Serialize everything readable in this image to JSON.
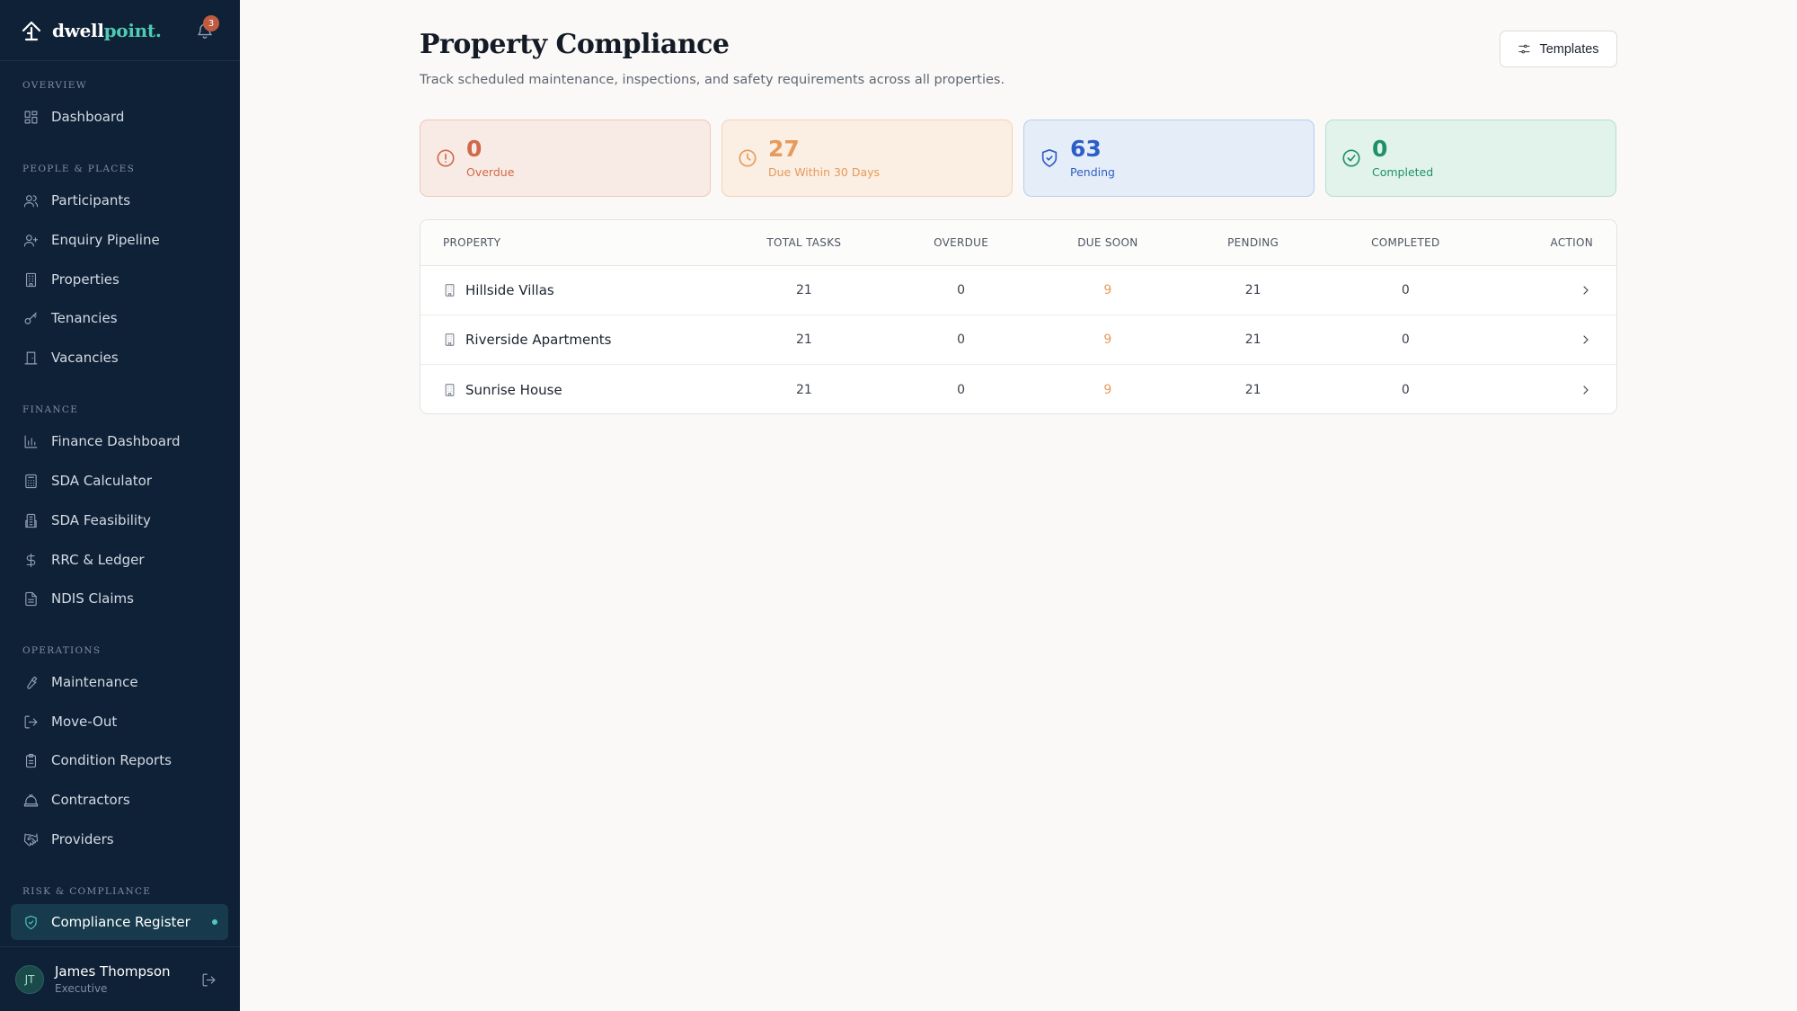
{
  "brand": {
    "name_part1": "dwell",
    "name_part2": "point.",
    "notification_count": "3"
  },
  "sidebar": {
    "sections": {
      "overview": "Overview",
      "people": "People & Places",
      "finance": "Finance",
      "operations": "Operations",
      "risk": "Risk & Compliance"
    },
    "items": {
      "dashboard": "Dashboard",
      "participants": "Participants",
      "enquiry": "Enquiry Pipeline",
      "properties": "Properties",
      "tenancies": "Tenancies",
      "vacancies": "Vacancies",
      "finance_dashboard": "Finance Dashboard",
      "sda_calculator": "SDA Calculator",
      "sda_feasibility": "SDA Feasibility",
      "rrc_ledger": "RRC & Ledger",
      "ndis_claims": "NDIS Claims",
      "maintenance": "Maintenance",
      "move_out": "Move-Out",
      "condition_reports": "Condition Reports",
      "contractors": "Contractors",
      "providers": "Providers",
      "compliance_register": "Compliance Register"
    }
  },
  "user": {
    "initials": "JT",
    "name": "James Thompson",
    "role": "Executive"
  },
  "page": {
    "title": "Property Compliance",
    "subtitle": "Track scheduled maintenance, inspections, and safety requirements across all properties.",
    "templates_label": "Templates"
  },
  "stats": {
    "overdue": {
      "value": "0",
      "label": "Overdue"
    },
    "due": {
      "value": "27",
      "label": "Due Within 30 Days"
    },
    "pending": {
      "value": "63",
      "label": "Pending"
    },
    "completed": {
      "value": "0",
      "label": "Completed"
    }
  },
  "table": {
    "headers": {
      "property": "PROPERTY",
      "total": "TOTAL TASKS",
      "overdue": "OVERDUE",
      "due": "DUE SOON",
      "pending": "PENDING",
      "completed": "COMPLETED",
      "action": "ACTION"
    },
    "rows": [
      {
        "property": "Hillside Villas",
        "total": "21",
        "overdue": "0",
        "due": "9",
        "pending": "21",
        "completed": "0"
      },
      {
        "property": "Riverside Apartments",
        "total": "21",
        "overdue": "0",
        "due": "9",
        "pending": "21",
        "completed": "0"
      },
      {
        "property": "Sunrise House",
        "total": "21",
        "overdue": "0",
        "due": "9",
        "pending": "21",
        "completed": "0"
      }
    ]
  },
  "colors": {
    "sidebar_bg": "#0f2136",
    "accent": "#4fcab4",
    "overdue": "#d0694a",
    "due": "#e69b5d",
    "pending": "#2d5ec5",
    "completed": "#1e9168"
  }
}
